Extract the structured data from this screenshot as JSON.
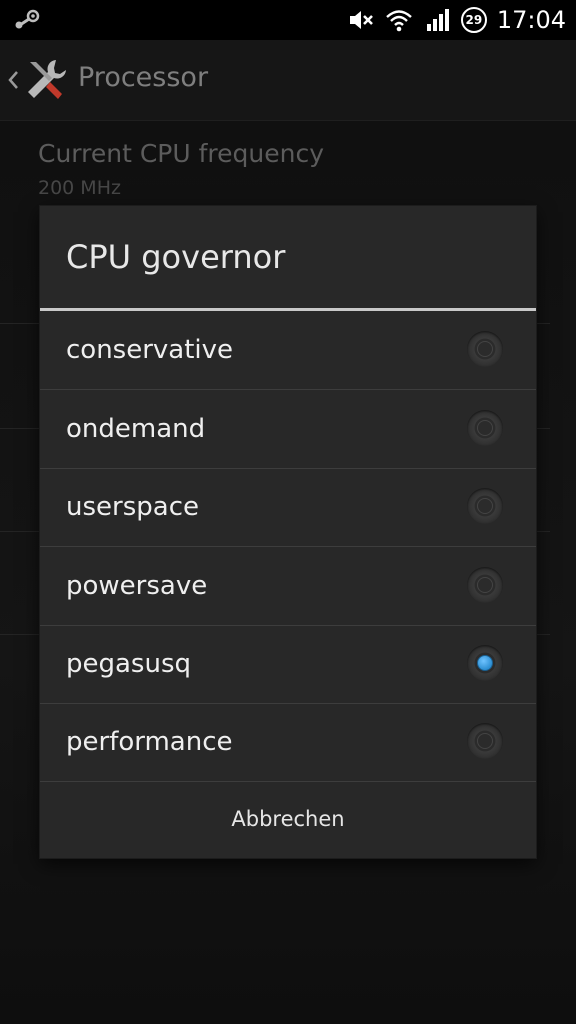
{
  "status_bar": {
    "left_icon": "steam-icon",
    "icons": [
      "mute-icon",
      "wifi-icon",
      "signal-icon"
    ],
    "notification_count": "29",
    "time": "17:04"
  },
  "action_bar": {
    "up_icon": "chevron-left-icon",
    "app_icon": "tools-icon",
    "title": "Processor"
  },
  "background": {
    "preference_title": "Current CPU frequency",
    "preference_summary": "200 MHz"
  },
  "dialog": {
    "title": "CPU governor",
    "options": [
      {
        "label": "conservative",
        "checked": false
      },
      {
        "label": "ondemand",
        "checked": false
      },
      {
        "label": "userspace",
        "checked": false
      },
      {
        "label": "powersave",
        "checked": false
      },
      {
        "label": "pegasusq",
        "checked": true
      },
      {
        "label": "performance",
        "checked": false
      }
    ],
    "cancel_label": "Abbrechen"
  },
  "colors": {
    "accent_radio": "#2d8fd3",
    "dialog_bg": "#282828",
    "title_divider": "#c9c9c9"
  }
}
